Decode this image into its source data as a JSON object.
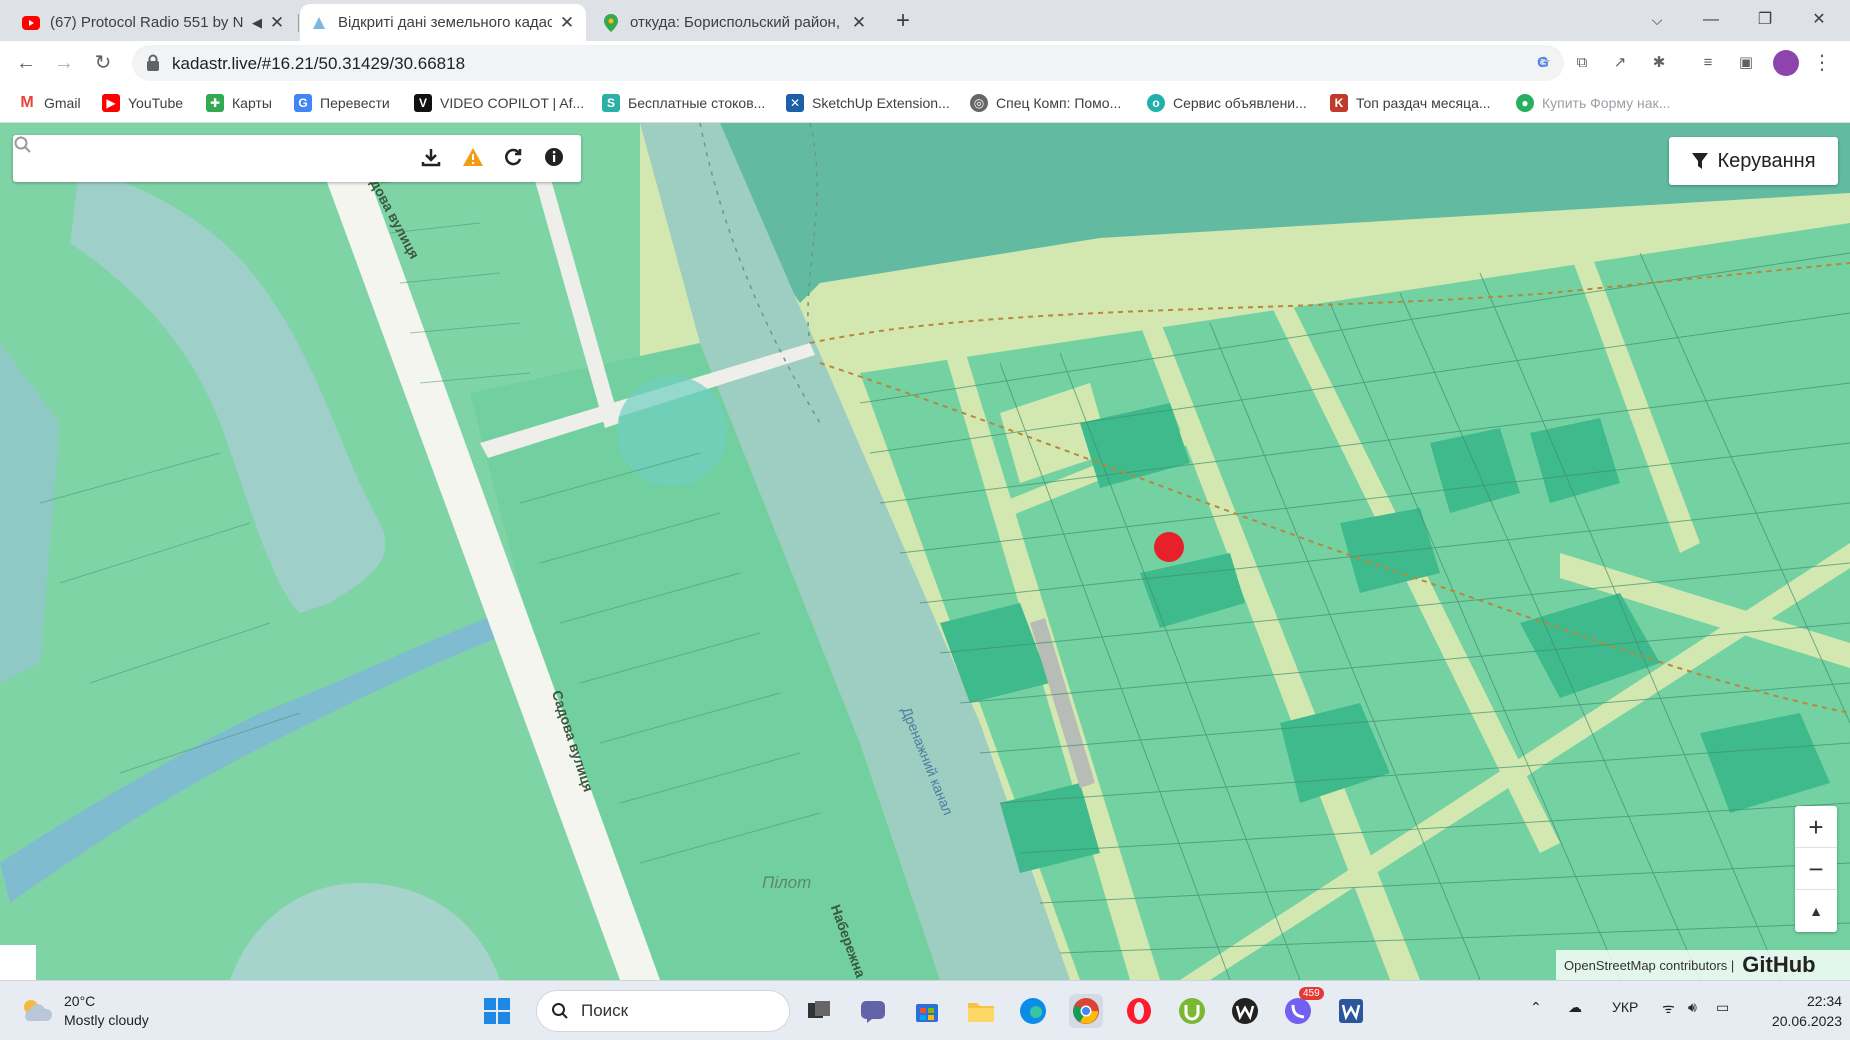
{
  "tabs": [
    {
      "title": "(67) Protocol Radio 551 by N",
      "icon": "youtube-icon",
      "muted_icon": "speaker-icon"
    },
    {
      "title": "Відкриті дані земельного кадас",
      "icon": "kadastr-icon"
    },
    {
      "title": "откуда: Бориспольский район, ",
      "icon": "maps-pin-icon"
    }
  ],
  "address": {
    "url": "kadastr.live/#16.21/50.31429/30.66818"
  },
  "bookmarks": [
    {
      "label": "Gmail",
      "icon": "gmail-icon"
    },
    {
      "label": "YouTube",
      "icon": "youtube-icon"
    },
    {
      "label": "Карты",
      "icon": "maps-icon"
    },
    {
      "label": "Перевести",
      "icon": "translate-icon"
    },
    {
      "label": "VIDEO COPILOT | Af...",
      "icon": "videocopilot-icon"
    },
    {
      "label": "Бесплатные стоков...",
      "icon": "stock-icon"
    },
    {
      "label": "SketchUp Extension...",
      "icon": "sketchup-icon"
    },
    {
      "label": "Спец Комп: Помо...",
      "icon": "globe-icon"
    },
    {
      "label": "Сервис объявлени...",
      "icon": "ads-icon"
    },
    {
      "label": "Топ раздач месяца...",
      "icon": "torrent-icon"
    },
    {
      "label": "Купить Форму нак...",
      "icon": "shop-icon"
    }
  ],
  "map": {
    "search_placeholder": "",
    "control_button": "Керування",
    "zoom_in": "+",
    "zoom_out": "−",
    "reset_north": "▲",
    "attribution": "OpenStreetMap contributors |",
    "attribution_brand": "GitHub",
    "street_labels": [
      "Садова вулиця",
      "Садова вулиця",
      "Дренажний канал",
      "Пілот",
      "Набережна"
    ],
    "marker_color": "#e8202a"
  },
  "taskbar": {
    "weather_temp": "20°C",
    "weather_desc": "Mostly cloudy",
    "search_label": "Поиск",
    "viber_badge": "459",
    "language": "УКР",
    "time": "22:34",
    "date": "20.06.2023"
  }
}
